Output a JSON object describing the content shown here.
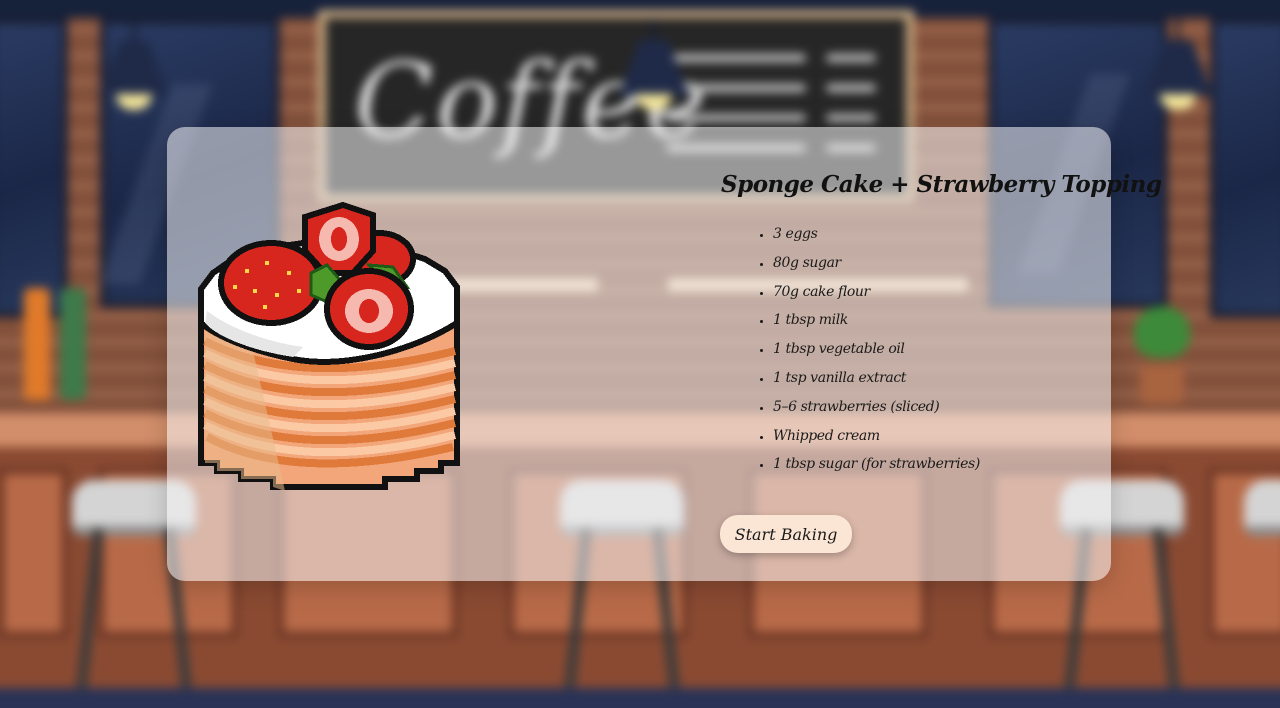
{
  "background": {
    "chalkboard_text": "Coffee",
    "colors": {
      "wall": "#8a5540",
      "counter": "#8a4a32",
      "windows": "#1b2747",
      "chalkboard": "#262626"
    }
  },
  "card": {
    "image_name": "strawberry-sponge-cake-pixel-art",
    "title": "Sponge Cake + Strawberry Topping",
    "ingredients": [
      "3 eggs",
      "80g sugar",
      "70g cake flour",
      "1 tbsp milk",
      "1 tbsp vegetable oil",
      "1 tsp vanilla extract",
      "5–6 strawberries (sliced)",
      "Whipped cream",
      "1 tbsp sugar (for strawberries)"
    ],
    "start_button": "Start Baking",
    "colors": {
      "card_bg": "rgba(245,245,248,0.55)",
      "button_bg": "#fbe6d6",
      "strawberry": "#d7261e",
      "cream": "#ffffff",
      "sponge": "#f2a67a"
    }
  }
}
